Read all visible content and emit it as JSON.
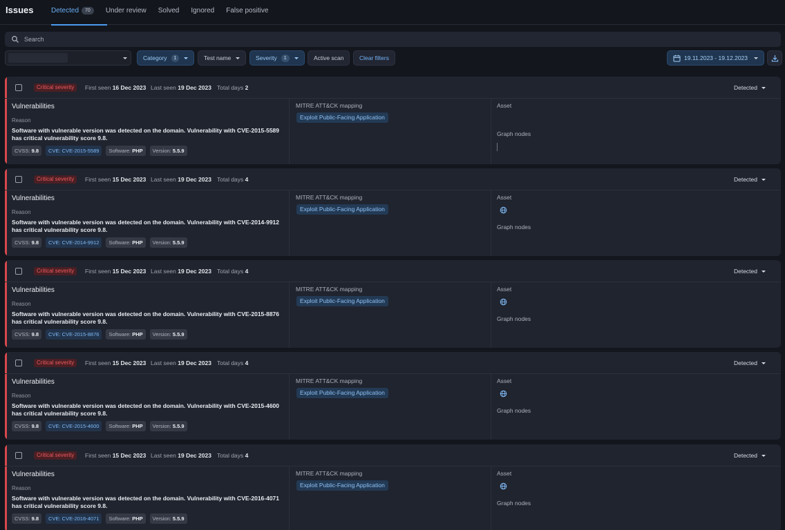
{
  "header": {
    "title": "Issues",
    "tabs": [
      {
        "label": "Detected",
        "count": "70"
      },
      {
        "label": "Under review"
      },
      {
        "label": "Solved"
      },
      {
        "label": "Ignored"
      },
      {
        "label": "False positive"
      }
    ]
  },
  "search": {
    "placeholder": "Search"
  },
  "filters": {
    "category": {
      "label": "Category",
      "count": "1"
    },
    "test_name": {
      "label": "Test name"
    },
    "severity": {
      "label": "Severity",
      "count": "1"
    },
    "active_scan": "Active scan",
    "clear": "Clear filters",
    "date_range": "19.11.2023 - 19.12.2023"
  },
  "labels": {
    "first_seen": "First seen",
    "last_seen": "Last seen",
    "total_days": "Total days",
    "category": "Vulnerabilities",
    "reason": "Reason",
    "mitre": "MITRE ATT&CK mapping",
    "asset": "Asset",
    "graph_nodes": "Graph nodes",
    "cvss": "CVSS:",
    "cve": "CVE:",
    "software": "Software:",
    "version": "Version:"
  },
  "issues": [
    {
      "severity": "Critical severity",
      "first_seen": "16 Dec 2023",
      "last_seen": "19 Dec 2023",
      "total_days": "2",
      "status": "Detected",
      "reason": "Software with vulnerable version was detected on the domain. Vulnerability with CVE-2015-5589 has critical vulnerability score 9.8.",
      "cvss": "9.8",
      "cve": "CVE-2015-5589",
      "software": "PHP",
      "version": "5.5.9",
      "mitre": "Exploit Public-Facing Application",
      "asset_icon": ""
    },
    {
      "severity": "Critical severity",
      "first_seen": "15 Dec 2023",
      "last_seen": "19 Dec 2023",
      "total_days": "4",
      "status": "Detected",
      "reason": "Software with vulnerable version was detected on the domain. Vulnerability with CVE-2014-9912 has critical vulnerability score 9.8.",
      "cvss": "9.8",
      "cve": "CVE-2014-9912",
      "software": "PHP",
      "version": "5.5.9",
      "mitre": "Exploit Public-Facing Application",
      "asset_icon": "globe-icon"
    },
    {
      "severity": "Critical severity",
      "first_seen": "15 Dec 2023",
      "last_seen": "19 Dec 2023",
      "total_days": "4",
      "status": "Detected",
      "reason": "Software with vulnerable version was detected on the domain. Vulnerability with CVE-2015-8876 has critical vulnerability score 9.8.",
      "cvss": "9.8",
      "cve": "CVE-2015-8876",
      "software": "PHP",
      "version": "5.5.9",
      "mitre": "Exploit Public-Facing Application",
      "asset_icon": "globe-icon"
    },
    {
      "severity": "Critical severity",
      "first_seen": "15 Dec 2023",
      "last_seen": "19 Dec 2023",
      "total_days": "4",
      "status": "Detected",
      "reason": "Software with vulnerable version was detected on the domain. Vulnerability with CVE-2015-4600 has critical vulnerability score 9.8.",
      "cvss": "9.8",
      "cve": "CVE-2015-4600",
      "software": "PHP",
      "version": "5.5.9",
      "mitre": "Exploit Public-Facing Application",
      "asset_icon": "globe-icon"
    },
    {
      "severity": "Critical severity",
      "first_seen": "15 Dec 2023",
      "last_seen": "19 Dec 2023",
      "total_days": "4",
      "status": "Detected",
      "reason": "Software with vulnerable version was detected on the domain. Vulnerability with CVE-2016-4071 has critical vulnerability score 9.8.",
      "cvss": "9.8",
      "cve": "CVE-2016-4071",
      "software": "PHP",
      "version": "5.5.9",
      "mitre": "Exploit Public-Facing Application",
      "asset_icon": "globe-icon"
    }
  ],
  "colors": {
    "background": "#13161d",
    "card": "#20242e",
    "critical": "#d8484c",
    "accent": "#4d9cf0"
  }
}
